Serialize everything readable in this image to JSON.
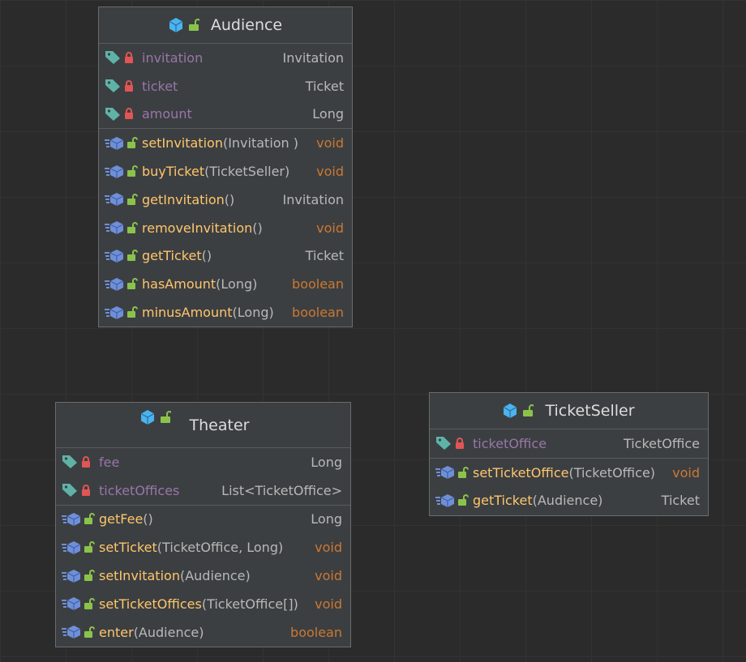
{
  "classes": {
    "audience": {
      "name": "Audience",
      "fields": [
        {
          "name": "invitation",
          "type": "Invitation"
        },
        {
          "name": "ticket",
          "type": "Ticket"
        },
        {
          "name": "amount",
          "type": "Long"
        }
      ],
      "methods": [
        {
          "name": "setInvitation",
          "params": "(Invitation )",
          "type": "void"
        },
        {
          "name": "buyTicket",
          "params": "(TicketSeller)",
          "type": "void"
        },
        {
          "name": "getInvitation",
          "params": " ()",
          "type": "Invitation"
        },
        {
          "name": "removeInvitation",
          "params": " ()",
          "type": "void"
        },
        {
          "name": "getTicket",
          "params": "()",
          "type": "Ticket"
        },
        {
          "name": "hasAmount",
          "params": " (Long)",
          "type": "boolean"
        },
        {
          "name": "minusAmount",
          "params": " (Long)",
          "type": "boolean"
        }
      ]
    },
    "theater": {
      "name": "Theater",
      "fields": [
        {
          "name": "fee",
          "type": "Long"
        },
        {
          "name": "ticketOffices",
          "type": "List<TicketOffice>"
        }
      ],
      "methods": [
        {
          "name": "getFee",
          "params": "()",
          "type": "Long"
        },
        {
          "name": "setTicket",
          "params": "(TicketOffice, Long)",
          "type": "void"
        },
        {
          "name": "setInvitation",
          "params": " (Audience)",
          "type": "void"
        },
        {
          "name": "setTicketOffices",
          "params": "(TicketOffice[])",
          "type": "void"
        },
        {
          "name": "enter",
          "params": "(Audience)",
          "type": "boolean"
        }
      ]
    },
    "ticketSeller": {
      "name": "TicketSeller",
      "fields": [
        {
          "name": "ticketOffice",
          "type": "TicketOffice"
        }
      ],
      "methods": [
        {
          "name": "setTicketOffice",
          "params": "(TicketOffice)",
          "type": "void"
        },
        {
          "name": "getTicket",
          "params": "(Audience)",
          "type": "Ticket"
        }
      ]
    }
  },
  "colors": {
    "background": "#2b2b2b",
    "box": "#3c3f41",
    "field": "#9876aa",
    "method": "#ffc66d",
    "keyword_type": "#cc7832",
    "class_icon": "#4ab3f0",
    "lock_private": "#e05555",
    "lock_public": "#8bc34a",
    "field_tag": "#5fb3a6",
    "method_icon": "#6f8fd8"
  },
  "icons": {
    "class": "class-cube-icon",
    "public": "unlocked-icon",
    "private": "locked-icon",
    "field": "field-tag-icon",
    "method": "method-icon"
  }
}
